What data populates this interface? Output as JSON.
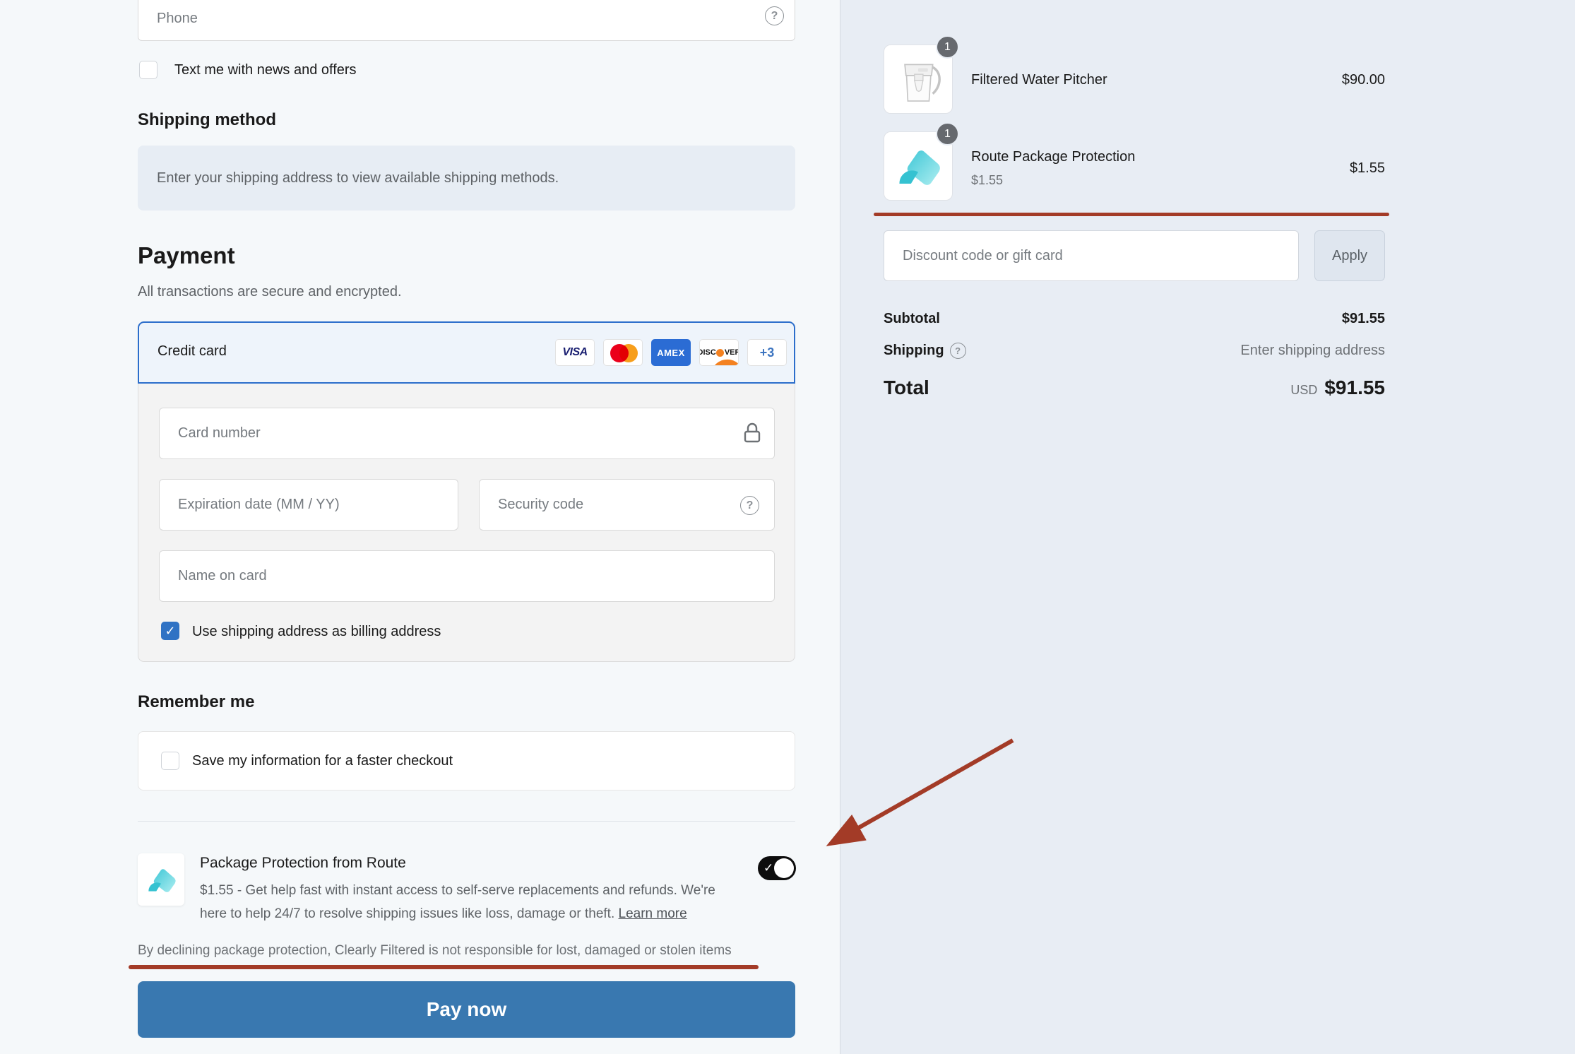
{
  "left": {
    "phone": {
      "placeholder": "Phone"
    },
    "sms_optin_label": "Text me with news and offers",
    "shipping_method": {
      "heading": "Shipping method",
      "notice": "Enter your shipping address to view available shipping methods."
    },
    "payment": {
      "heading": "Payment",
      "subheading": "All transactions are secure and encrypted.",
      "method_label": "Credit card",
      "icons": {
        "visa": "VISA",
        "amex": "AMEX",
        "discover_left": "DISC",
        "discover_right": "VER",
        "more": "+3"
      },
      "card_number_placeholder": "Card number",
      "expiration_placeholder": "Expiration date (MM / YY)",
      "security_placeholder": "Security code",
      "name_placeholder": "Name on card",
      "billing_checkbox_label": "Use shipping address as billing address"
    },
    "remember": {
      "heading": "Remember me",
      "save_label": "Save my information for a faster checkout"
    },
    "route": {
      "title": "Package Protection from Route",
      "description": "$1.55 - Get help fast with instant access to self-serve replacements and refunds. We're here to help 24/7 to resolve shipping issues like loss, damage or theft.",
      "learn_more": "Learn more"
    },
    "decline_note": "By declining package protection, Clearly Filtered is not responsible for lost, damaged or stolen items",
    "pay_button": "Pay now"
  },
  "summary": {
    "items": [
      {
        "name": "Filtered Water Pitcher",
        "qty": "1",
        "price": "$90.00"
      },
      {
        "name": "Route Package Protection",
        "qty": "1",
        "unit_price": "$1.55",
        "price": "$1.55"
      }
    ],
    "discount": {
      "placeholder": "Discount code or gift card",
      "apply_label": "Apply"
    },
    "totals": {
      "subtotal_label": "Subtotal",
      "subtotal_value": "$91.55",
      "shipping_label": "Shipping",
      "shipping_value": "Enter shipping address",
      "total_label": "Total",
      "currency": "USD",
      "total_value": "$91.55"
    }
  },
  "colors": {
    "accent_blue": "#2c6ecb",
    "pay_button_blue": "#3978b0",
    "annotation_red": "#a33b27",
    "route_teal": "#45cdd9",
    "sidebar_bg": "#e8edf4"
  }
}
